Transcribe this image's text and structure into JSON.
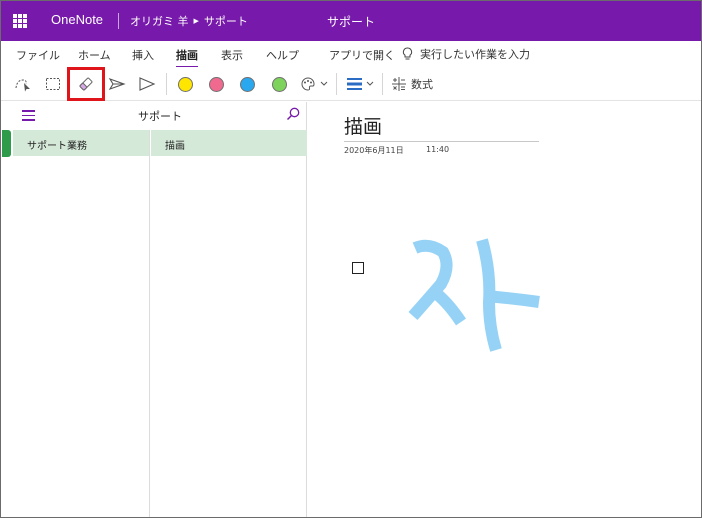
{
  "app": {
    "name": "OneNote",
    "notebook": "オリガミ 羊",
    "section": "サポート",
    "window_title": "サポート"
  },
  "ribbon": {
    "tabs": [
      {
        "label": "ファイル"
      },
      {
        "label": "ホーム"
      },
      {
        "label": "挿入"
      },
      {
        "label": "描画",
        "active": true
      },
      {
        "label": "表示"
      },
      {
        "label": "ヘルプ"
      },
      {
        "label": "アプリで開く"
      }
    ],
    "tell_me": "実行したい作業を入力"
  },
  "toolbar": {
    "tools": [
      {
        "icon": "lasso-select-icon"
      },
      {
        "icon": "rectangle-select-icon"
      },
      {
        "icon": "eraser-icon",
        "highlighted": true
      },
      {
        "icon": "pen-icon"
      },
      {
        "icon": "highlighter-icon"
      }
    ],
    "pen_colors": [
      {
        "name": "yellow",
        "color": "#ffe600"
      },
      {
        "name": "pink",
        "color": "#f06a8f"
      },
      {
        "name": "blue",
        "color": "#29a8f0"
      },
      {
        "name": "green",
        "color": "#7dd35c"
      }
    ],
    "math_label": "数式",
    "highlight_color": "#e0141b"
  },
  "nav": {
    "title": "サポート",
    "sections": [
      {
        "label": "サポート業務",
        "selected": true
      }
    ],
    "pages": [
      {
        "label": "描画",
        "selected": true
      }
    ],
    "selected_bg": "#d5e9d9",
    "accent_color": "#2e9b4b"
  },
  "page": {
    "title": "描画",
    "date": "2020年6月11日",
    "time": "11:40",
    "ink_color": "#7cc8f4"
  },
  "colors": {
    "titlebar": "#7719aa",
    "accent": "#7719aa"
  }
}
